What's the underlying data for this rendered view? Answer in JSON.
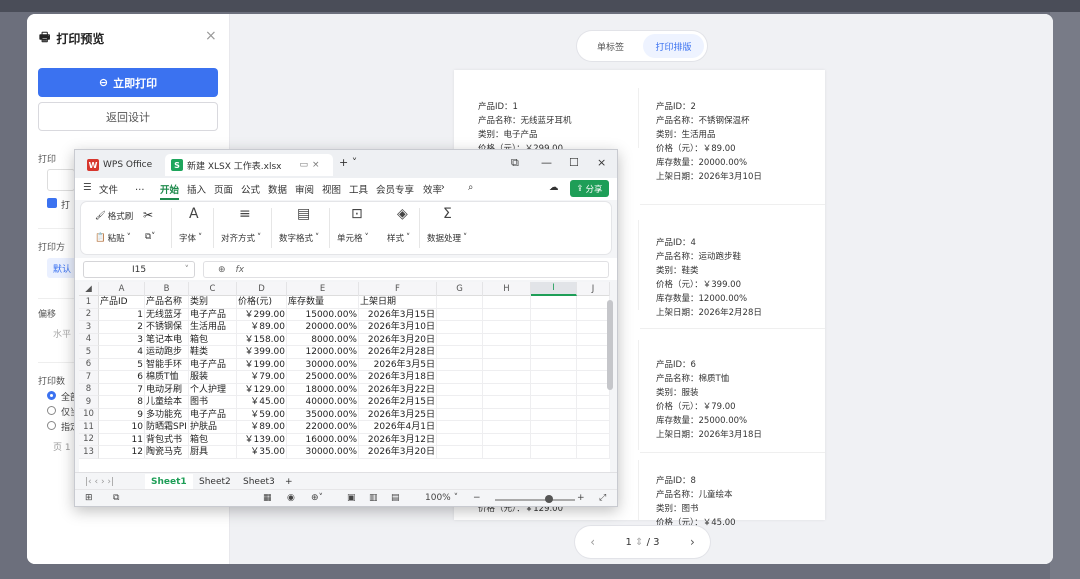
{
  "dialog": {
    "title": "打印预览",
    "print_now": "立即打印",
    "back_design": "返回设计"
  },
  "left_panel": {
    "printer_label": "打印",
    "check_label": "打",
    "direction_label": "打印方",
    "direction_chip": "默认",
    "offset_label": "偏移",
    "offset_h": "水平",
    "range_label": "打印数",
    "radio1": "全部",
    "radio2": "仅当",
    "radio3": "指定",
    "pages_label": "页 1"
  },
  "preview": {
    "tabs": [
      "单标签",
      "打印排版"
    ],
    "active_tab": 1,
    "labels": [
      {
        "id": "产品ID：1",
        "name": "产品名称：无线蓝牙耳机",
        "cat": "类别：电子产品",
        "price": "价格（元）：￥299.00",
        "stock": "",
        "date": ""
      },
      {
        "id": "产品ID：2",
        "name": "产品名称：不锈钢保温杯",
        "cat": "类别：生活用品",
        "price": "价格（元）：￥89.00",
        "stock": "库存数量：20000.00%",
        "date": "上架日期：2026年3月10日"
      },
      {
        "id": "产品ID：4",
        "name": "产品名称：运动跑步鞋",
        "cat": "类别：鞋类",
        "price": "价格（元）：￥399.00",
        "stock": "库存数量：12000.00%",
        "date": "上架日期：2026年2月28日"
      },
      {
        "id": "产品ID：6",
        "name": "产品名称：棉质T恤",
        "cat": "类别：服装",
        "price": "价格（元）：￥79.00",
        "stock": "库存数量：25000.00%",
        "date": "上架日期：2026年3月18日"
      },
      {
        "id": "产品ID：8",
        "name": "产品名称：儿童绘本",
        "cat": "类别：图书",
        "price": "价格（元）：￥45.00",
        "stock": "",
        "date": ""
      },
      {
        "price_left": "价格（元）：￥129.00"
      }
    ],
    "pager": {
      "current": "1",
      "total": "/ 3"
    }
  },
  "wps": {
    "tab_home": "WPS Office",
    "tab_file": "新建 XLSX 工作表.xlsx",
    "menu": [
      "文件",
      "…",
      "开始",
      "插入",
      "页面",
      "公式",
      "数据",
      "审阅",
      "视图",
      "工具",
      "会员专享",
      "效率"
    ],
    "share": "分享",
    "ribbon": {
      "format_brush": "格式刷",
      "paste": "粘贴",
      "font": "字体",
      "align": "对齐方式",
      "number": "数字格式",
      "cell": "单元格",
      "style": "样式",
      "data": "数据处理"
    },
    "namebox": "I15",
    "fx": "fx",
    "columns": [
      "A",
      "B",
      "C",
      "D",
      "E",
      "F",
      "G",
      "H",
      "I",
      "J"
    ],
    "rows": [
      [
        "产品ID",
        "产品名称",
        "类别",
        "价格(元)",
        "库存数量",
        "上架日期"
      ],
      [
        "1",
        "无线蓝牙",
        "电子产品",
        "￥299.00",
        "15000.00%",
        "2026年3月15日"
      ],
      [
        "2",
        "不锈钢保",
        "生活用品",
        "￥89.00",
        "20000.00%",
        "2026年3月10日"
      ],
      [
        "3",
        "笔记本电",
        "箱包",
        "￥158.00",
        "8000.00%",
        "2026年3月20日"
      ],
      [
        "4",
        "运动跑步",
        "鞋类",
        "￥399.00",
        "12000.00%",
        "2026年2月28日"
      ],
      [
        "5",
        "智能手环",
        "电子产品",
        "￥199.00",
        "30000.00%",
        "2026年3月5日"
      ],
      [
        "6",
        "棉质T恤",
        "服装",
        "￥79.00",
        "25000.00%",
        "2026年3月18日"
      ],
      [
        "7",
        "电动牙刷",
        "个人护理",
        "￥129.00",
        "18000.00%",
        "2026年3月22日"
      ],
      [
        "8",
        "儿童绘本",
        "图书",
        "￥45.00",
        "40000.00%",
        "2026年2月15日"
      ],
      [
        "9",
        "多功能充",
        "电子产品",
        "￥59.00",
        "35000.00%",
        "2026年3月25日"
      ],
      [
        "10",
        "防晒霜SPI",
        "护肤品",
        "￥89.00",
        "22000.00%",
        "2026年4月1日"
      ],
      [
        "11",
        "背包式书",
        "箱包",
        "￥139.00",
        "16000.00%",
        "2026年3月12日"
      ],
      [
        "12",
        "陶瓷马克",
        "厨具",
        "￥35.00",
        "30000.00%",
        "2026年3月20日"
      ]
    ],
    "sheets": [
      "Sheet1",
      "Sheet2",
      "Sheet3",
      "+"
    ],
    "zoom": "100%"
  }
}
